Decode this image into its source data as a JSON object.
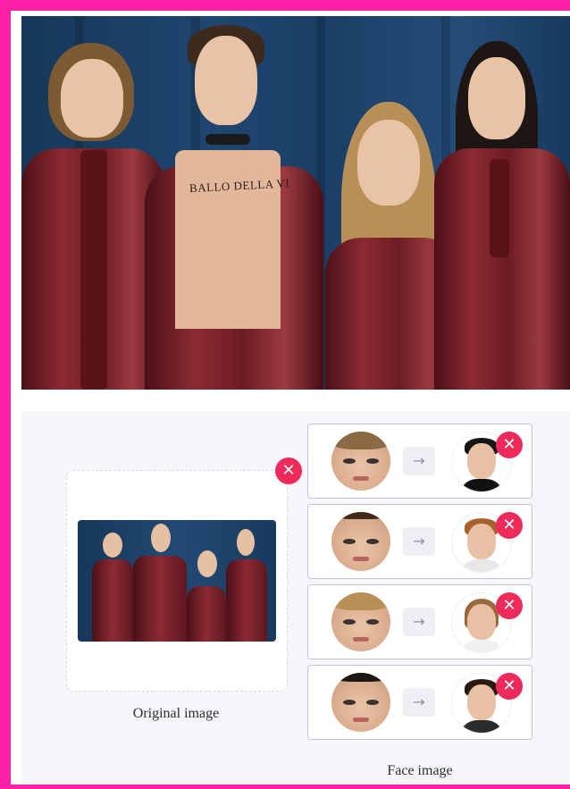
{
  "colors": {
    "border": "#ff1fa8",
    "close": "#ee2a5b",
    "row_border": "#c9bde8",
    "panel_bg": "#f6f6fa"
  },
  "hero": {
    "tattoo_text": "BALLO DELLA VI"
  },
  "original": {
    "label": "Original image",
    "close_icon": "close-icon"
  },
  "face_swap": {
    "label": "Face image",
    "arrow_glyph": "→",
    "close_glyph": "✕",
    "rows": [
      {
        "source": "source-face-1",
        "target": "target-face-1"
      },
      {
        "source": "source-face-2",
        "target": "target-face-2"
      },
      {
        "source": "source-face-3",
        "target": "target-face-3"
      },
      {
        "source": "source-face-4",
        "target": "target-face-4"
      }
    ]
  }
}
